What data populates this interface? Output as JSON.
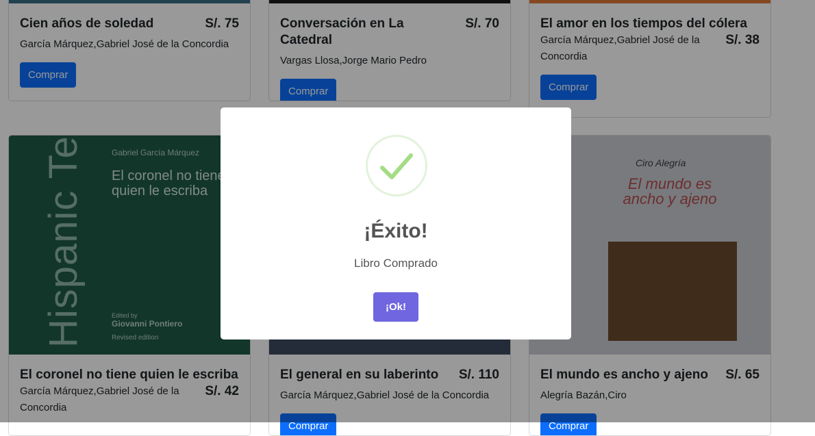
{
  "cards": [
    {
      "title": "Cien años de soledad",
      "price": "S/. 75",
      "author": "García Márquez,Gabriel José de la Concordia",
      "button": "Comprar"
    },
    {
      "title": "Conversación en La Catedral",
      "price": "S/. 70",
      "author": "Vargas Llosa,Jorge Mario Pedro",
      "button": "Comprar"
    },
    {
      "title": "El amor en los tiempos del cólera",
      "price": "S/. 38",
      "author": "García Márquez,Gabriel José de la Concordia",
      "button": "Comprar"
    },
    {
      "title": "El coronel no tiene quien le escriba",
      "price": "S/. 42",
      "author": "García Márquez,Gabriel José de la Concordia",
      "button": "Comprar"
    },
    {
      "title": "El general en su laberinto",
      "price": "S/. 110",
      "author": "García Márquez,Gabriel José de la Concordia",
      "button": "Comprar"
    },
    {
      "title": "El mundo es ancho y ajeno",
      "price": "S/. 65",
      "author": "Alegría Bazán,Ciro",
      "button": "Comprar"
    }
  ],
  "covers": {
    "coronel": {
      "series": "Hispanic Texts",
      "author": "Gabriel García Márquez",
      "title": "El coronel no tiene quien le escriba",
      "editor_label": "Edited by",
      "editor": "Giovanni Pontiero",
      "edition": "Revised edition"
    },
    "mundo": {
      "author": "Ciro Alegría",
      "title": "El mundo es ancho y ajeno"
    }
  },
  "modal": {
    "title": "¡Éxito!",
    "text": "Libro Comprado",
    "ok": "¡Ok!",
    "icon": "check-icon",
    "success_color": "#a5dc86",
    "button_color": "#7066e0"
  }
}
